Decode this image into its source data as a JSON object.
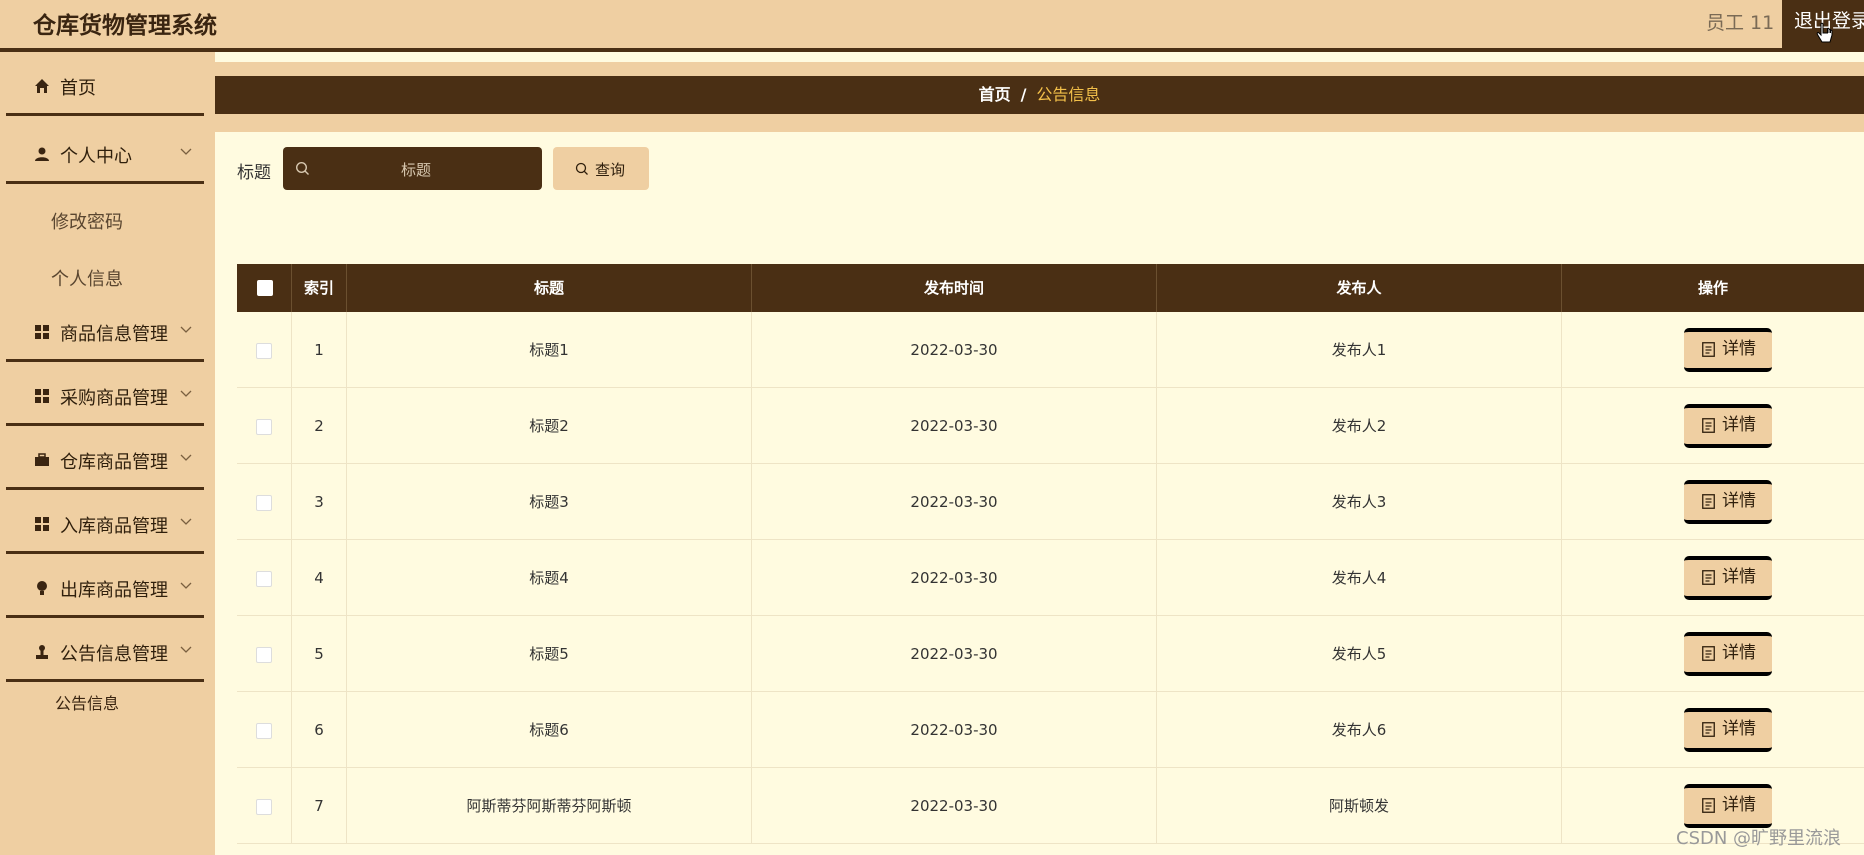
{
  "header": {
    "app_title": "仓库货物管理系统",
    "user": "员工 11",
    "logout_label": "退出登录"
  },
  "sidebar": {
    "items": [
      {
        "label": "首页",
        "icon": "home-icon"
      },
      {
        "label": "个人中心",
        "icon": "user-icon",
        "sub": [
          "修改密码",
          "个人信息"
        ]
      },
      {
        "label": "商品信息管理",
        "icon": "grid-icon"
      },
      {
        "label": "采购商品管理",
        "icon": "grid-icon"
      },
      {
        "label": "仓库商品管理",
        "icon": "briefcase-icon"
      },
      {
        "label": "入库商品管理",
        "icon": "grid-icon"
      },
      {
        "label": "出库商品管理",
        "icon": "bulb-icon"
      },
      {
        "label": "公告信息管理",
        "icon": "stamp-icon",
        "sub": [
          "公告信息"
        ]
      }
    ]
  },
  "breadcrumb": {
    "home": "首页",
    "separator": "/",
    "current": "公告信息"
  },
  "filter": {
    "label": "标题",
    "placeholder": "标题",
    "query_label": "查询"
  },
  "table": {
    "columns": [
      "索引",
      "标题",
      "发布时间",
      "发布人",
      "操作"
    ],
    "detail_label": "详情",
    "rows": [
      {
        "index": "1",
        "title": "标题1",
        "time": "2022-03-30",
        "publisher": "发布人1"
      },
      {
        "index": "2",
        "title": "标题2",
        "time": "2022-03-30",
        "publisher": "发布人2"
      },
      {
        "index": "3",
        "title": "标题3",
        "time": "2022-03-30",
        "publisher": "发布人3"
      },
      {
        "index": "4",
        "title": "标题4",
        "time": "2022-03-30",
        "publisher": "发布人4"
      },
      {
        "index": "5",
        "title": "标题5",
        "time": "2022-03-30",
        "publisher": "发布人5"
      },
      {
        "index": "6",
        "title": "标题6",
        "time": "2022-03-30",
        "publisher": "发布人6"
      },
      {
        "index": "7",
        "title": "阿斯蒂芬阿斯蒂芬阿斯顿",
        "time": "2022-03-30",
        "publisher": "阿斯顿发"
      }
    ]
  },
  "watermark": "CSDN @旷野里流浪",
  "colors": {
    "dark_brown": "#4a2f14",
    "tan": "#efcfa2",
    "cream": "#fffbe0",
    "breadcrumb_current": "#f3c04a"
  }
}
